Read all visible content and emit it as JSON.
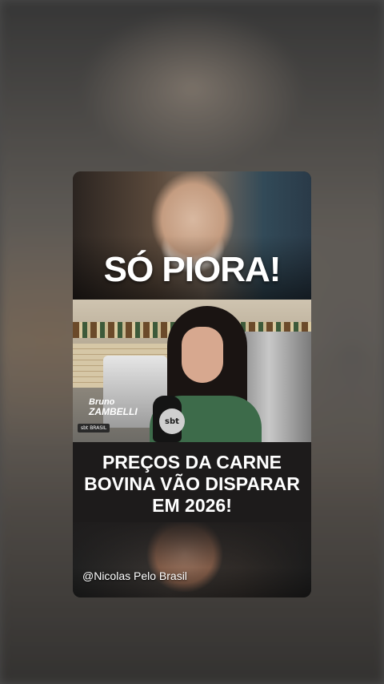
{
  "card": {
    "headline_top": "SÓ PIORA!",
    "brand_first": "Bruno",
    "brand_last": "ZAMBELLI",
    "mic_logo": "sbt",
    "channel_tag": "sbt BRASIL",
    "headline_main": "PREÇOS DA CARNE BOVINA VÃO DISPARAR EM 2026!",
    "author_handle": "@Nicolas Pelo Brasil"
  },
  "colors": {
    "background": "#5a5a5a",
    "caption_bg": "#1d1b1b",
    "text": "#ffffff"
  }
}
